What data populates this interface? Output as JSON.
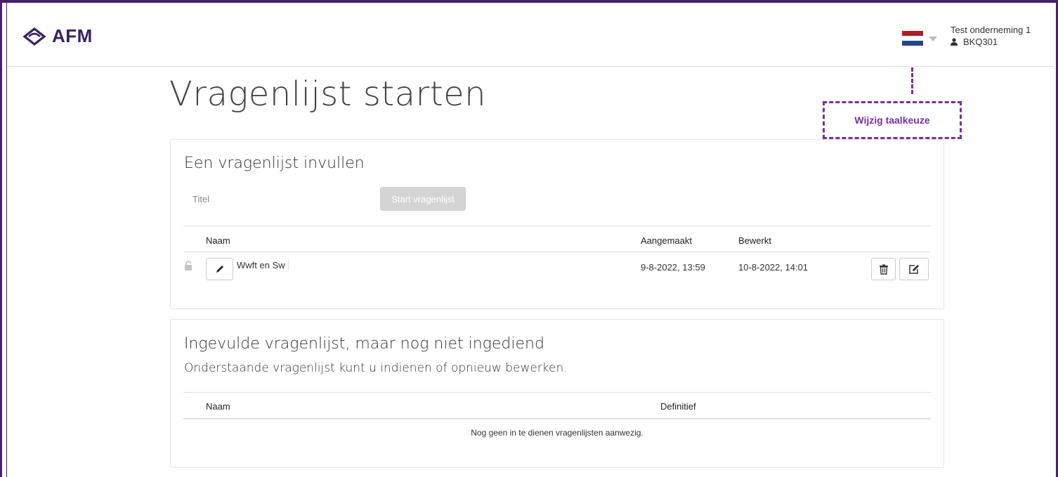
{
  "header": {
    "logo_text": "AFM",
    "company": "Test onderneming 1",
    "user_id": "BKQ301"
  },
  "language": {
    "flag_colors": [
      "#ae1c28",
      "#ffffff",
      "#21468b"
    ]
  },
  "callout": {
    "label": "Wijzig taalkeuze",
    "color": "#7a2da0"
  },
  "page": {
    "title": "Vragenlijst starten"
  },
  "fill_panel": {
    "heading": "Een vragenlijst invullen",
    "title_placeholder": "Titel",
    "start_button": "Start vragenlijst",
    "columns": {
      "name": "Naam",
      "created": "Aangemaakt",
      "edited": "Bewerkt"
    },
    "rows": [
      {
        "name": "Wwft en Sw",
        "created": "9-8-2022, 13:59",
        "edited": "10-8-2022, 14:01"
      }
    ]
  },
  "submitted_panel": {
    "heading": "Ingevulde vragenlijst, maar nog niet ingediend",
    "subheading": "Onderstaande vragenlijst kunt u indienen of opnieuw bewerken.",
    "columns": {
      "name": "Naam",
      "final": "Definitief"
    },
    "empty_message": "Nog geen in te dienen vragenlijsten aanwezig."
  }
}
